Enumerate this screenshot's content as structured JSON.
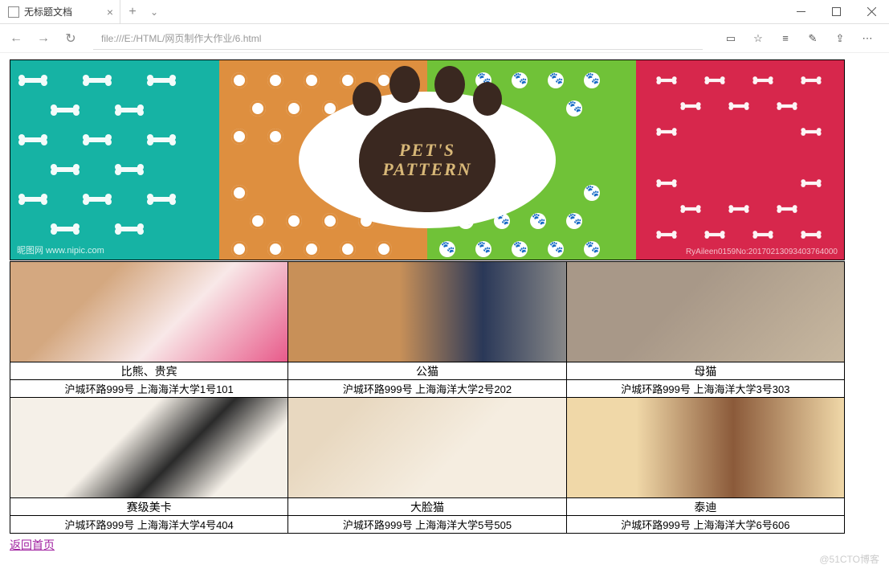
{
  "window": {
    "tab_title": "无标题文档",
    "url": "file:///E:/HTML/网页制作大作业/6.html"
  },
  "banner": {
    "line1": "PET'S",
    "line2": "PATTERN",
    "watermark_left": "昵图网 www.nipic.com",
    "watermark_right": "RyAileen0159No:20170213093403764000"
  },
  "pets": [
    {
      "name": "比熊、贵宾",
      "address": "沪城环路999号 上海海洋大学1号101"
    },
    {
      "name": "公猫",
      "address": "沪城环路999号 上海海洋大学2号202"
    },
    {
      "name": "母猫",
      "address": "沪城环路999号 上海海洋大学3号303"
    },
    {
      "name": "赛级美卡",
      "address": "沪城环路999号 上海海洋大学4号404"
    },
    {
      "name": "大脸猫",
      "address": "沪城环路999号 上海海洋大学5号505"
    },
    {
      "name": "泰迪",
      "address": "沪城环路999号 上海海洋大学6号606"
    }
  ],
  "back_link": "返回首页",
  "blog_mark": "@51CTO博客"
}
